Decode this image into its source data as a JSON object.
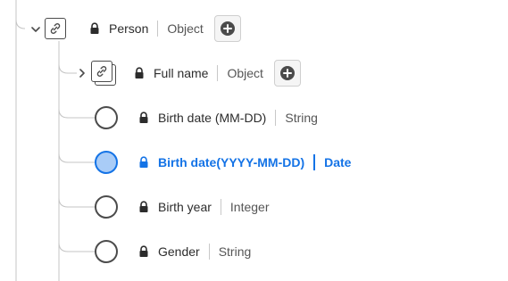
{
  "tree": {
    "root": {
      "name": "Person",
      "type": "Object",
      "expanded": true,
      "children": [
        {
          "name": "Full name",
          "type": "Object",
          "expanded": false,
          "kind": "object"
        },
        {
          "name": "Birth date (MM-DD)",
          "type": "String",
          "kind": "field",
          "selected": false
        },
        {
          "name": "Birth date(YYYY-MM-DD)",
          "type": "Date",
          "kind": "field",
          "selected": true
        },
        {
          "name": "Birth year",
          "type": "Integer",
          "kind": "field",
          "selected": false
        },
        {
          "name": "Gender",
          "type": "String",
          "kind": "field",
          "selected": false
        }
      ]
    }
  },
  "icons": {
    "lock": "lock-icon",
    "link": "link-icon",
    "add": "add-circle-icon",
    "chevron_down": "chevron-down-icon",
    "chevron_right": "chevron-right-icon"
  },
  "colors": {
    "selected_accent": "#1473e6",
    "selected_fill": "#a9ccf7",
    "line": "#bcbcbc",
    "text": "#2c2c2c"
  }
}
